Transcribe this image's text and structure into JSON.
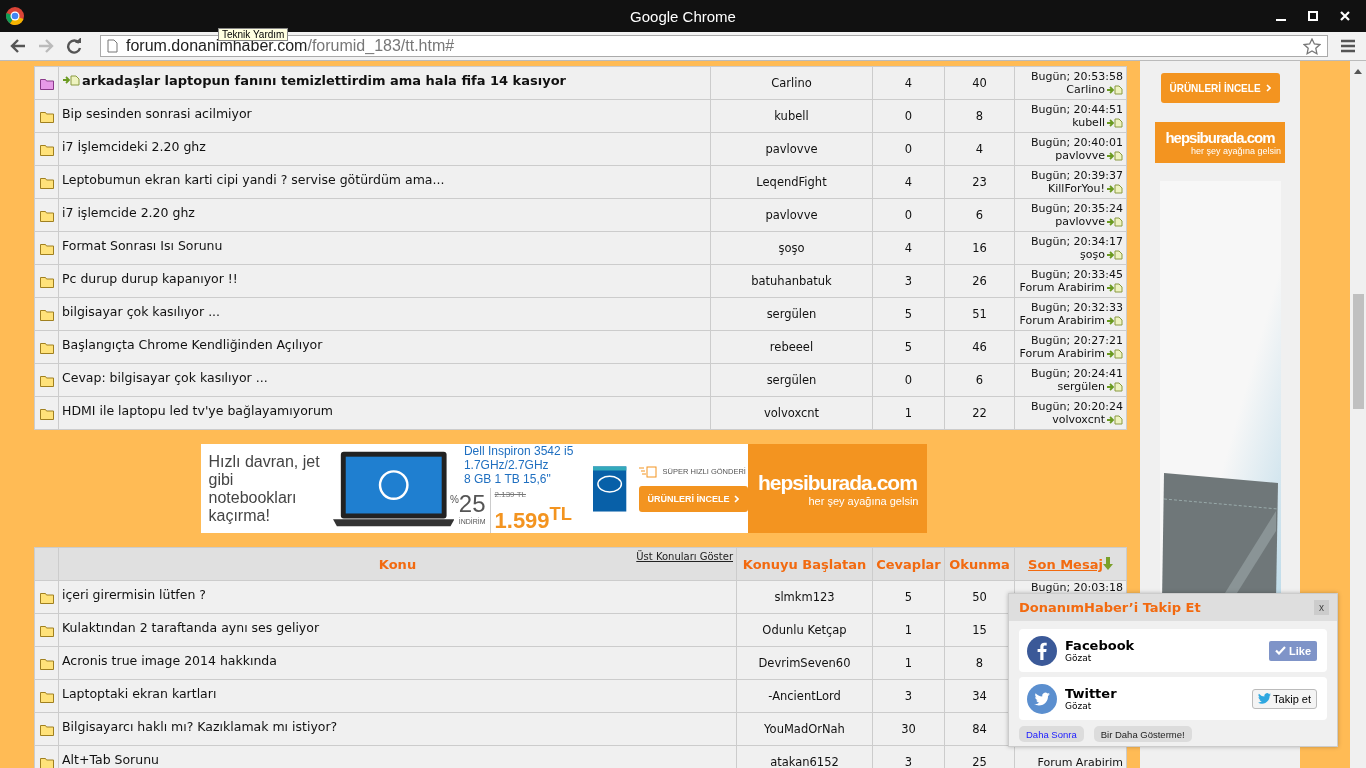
{
  "window": {
    "title": "Google Chrome"
  },
  "toolbar": {
    "url_host": "forum.donanimhaber.com",
    "url_path": "/forumid_183/tt.htm#",
    "tooltip": "Teknik Yardım"
  },
  "topics_top": [
    {
      "title": "arkadaşlar laptopun fanını temizlettirdim ama hala fifa 14 kasıyor",
      "unread": true,
      "starter": "Carlino",
      "replies": "4",
      "views": "40",
      "last_date": "Bugün; 20:53:58",
      "last_user": "Carlino"
    },
    {
      "title": "Bip sesinden sonrasi acilmiyor",
      "unread": false,
      "starter": "kubell",
      "replies": "0",
      "views": "8",
      "last_date": "Bugün; 20:44:51",
      "last_user": "kubell"
    },
    {
      "title": "i7 İşlemcideki 2.20 ghz",
      "unread": false,
      "starter": "pavlovve",
      "replies": "0",
      "views": "4",
      "last_date": "Bugün; 20:40:01",
      "last_user": "pavlovve"
    },
    {
      "title": "Leptobumun ekran karti cipi yandi ? servise götürdüm ama...",
      "unread": false,
      "starter": "LeqendFight",
      "replies": "4",
      "views": "23",
      "last_date": "Bugün; 20:39:37",
      "last_user": "KillForYou!"
    },
    {
      "title": "i7 işlemcide 2.20 ghz",
      "unread": false,
      "starter": "pavlovve",
      "replies": "0",
      "views": "6",
      "last_date": "Bugün; 20:35:24",
      "last_user": "pavlovve"
    },
    {
      "title": "Format Sonrası Isı Sorunu",
      "unread": false,
      "starter": "şoşo",
      "replies": "4",
      "views": "16",
      "last_date": "Bugün; 20:34:17",
      "last_user": "şoşo"
    },
    {
      "title": "Pc durup durup kapanıyor !!",
      "unread": false,
      "starter": "batuhanbatuk",
      "replies": "3",
      "views": "26",
      "last_date": "Bugün; 20:33:45",
      "last_user": "Forum Arabirim"
    },
    {
      "title": "bilgisayar çok kasılıyor ...",
      "unread": false,
      "starter": "sergülen",
      "replies": "5",
      "views": "51",
      "last_date": "Bugün; 20:32:33",
      "last_user": "Forum Arabirim"
    },
    {
      "title": "Başlangıçta Chrome Kendliğinden Açılıyor",
      "unread": false,
      "starter": "rebeeel",
      "replies": "5",
      "views": "46",
      "last_date": "Bugün; 20:27:21",
      "last_user": "Forum Arabirim"
    },
    {
      "title": "Cevap: bilgisayar çok kasılıyor ...",
      "unread": false,
      "starter": "sergülen",
      "replies": "0",
      "views": "6",
      "last_date": "Bugün; 20:24:41",
      "last_user": "sergülen"
    },
    {
      "title": "HDMI ile laptopu led tv'ye bağlayamıyorum",
      "unread": false,
      "starter": "volvoxcnt",
      "replies": "1",
      "views": "22",
      "last_date": "Bugün; 20:20:24",
      "last_user": "volvoxcnt"
    }
  ],
  "ad_banner": {
    "headline": "Hızlı davran, jet gibi notebookları kaçırma!",
    "product": [
      "Dell Inspiron 3542 i5",
      "1.7GHz/2.7GHz",
      "8 GB 1 TB 15,6\""
    ],
    "percent_sign": "%",
    "discount": "25",
    "discount_label": "İNDİRİM",
    "old_price": "2.139 TL",
    "price": "1.599$^{TL}$",
    "shipping": "SÜPER HIZLI GÖNDERİ",
    "button": "ÜRÜNLERİ İNCELE",
    "brand": "hepsiburada.com",
    "slogan": "her şey ayağına gelsin"
  },
  "topics_bottom": {
    "columns": {
      "topic": "Konu",
      "show_top": "Üst Konuları Göster",
      "starter": "Konuyu Başlatan",
      "replies": "Cevaplar",
      "views": "Okunma",
      "last": "Son Mesaj"
    },
    "rows": [
      {
        "title": "içeri girermisin lütfen ?",
        "unread": false,
        "starter": "slmkm123",
        "replies": "5",
        "views": "50",
        "last_date": "Bugün; 20:03:18"
      },
      {
        "title": "Kulaktından 2 taraftanda aynı ses geliyor",
        "unread": false,
        "starter": "Odunlu Ketçap",
        "replies": "1",
        "views": "15"
      },
      {
        "title": "Acronis true image 2014 hakkında",
        "unread": false,
        "starter": "DevrimSeven60",
        "replies": "1",
        "views": "8"
      },
      {
        "title": "Laptoptaki ekran kartları",
        "unread": false,
        "starter": "-AncientLord",
        "replies": "3",
        "views": "34"
      },
      {
        "title": "Bilgisayarcı haklı mı? Kazıklamak mı istiyor?",
        "unread": false,
        "starter": "YouMadOrNah",
        "replies": "30",
        "views": "84"
      },
      {
        "title": "Alt+Tab Sorunu",
        "unread": false,
        "starter": "atakan6152",
        "replies": "3",
        "views": "25",
        "last_user": "Forum Arabirim"
      }
    ]
  },
  "sidebar_ad": {
    "button": "ÜRÜNLERİ İNCELE",
    "brand": "hepsiburada.com",
    "slogan": "her şey ayağına gelsin"
  },
  "follow_popup": {
    "title": "DonanımHaber’i Takip Et",
    "close": "x",
    "networks": [
      {
        "kind": "facebook",
        "name": "Facebook",
        "sub": "Gözat",
        "button": "Like"
      },
      {
        "kind": "twitter",
        "name": "Twitter",
        "sub": "Gözat",
        "button": "Takip et"
      }
    ],
    "later": "Daha Sonra",
    "never": "Bir Daha Gösterme!"
  }
}
